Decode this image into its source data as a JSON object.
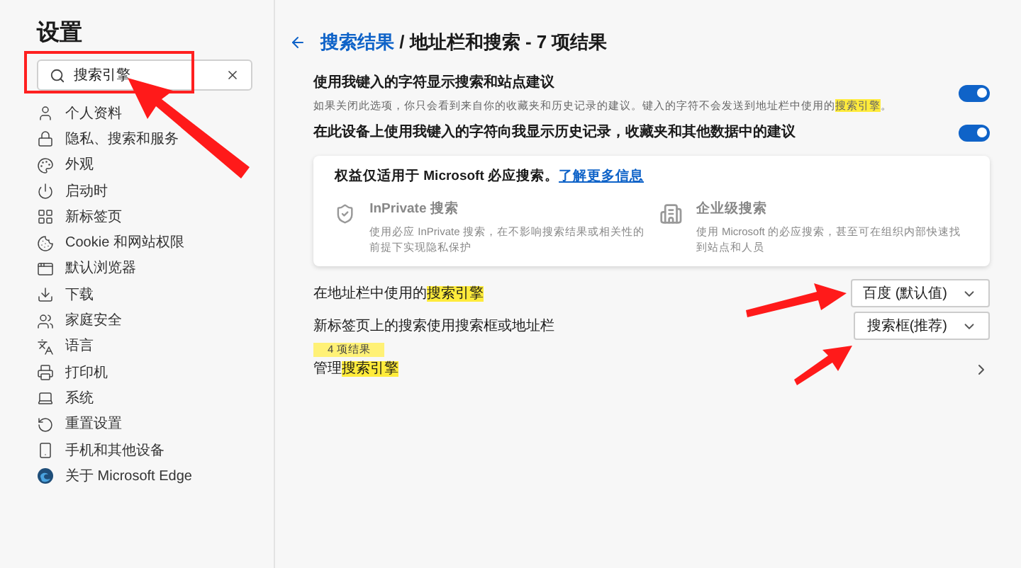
{
  "sidebar": {
    "title": "设置",
    "search": {
      "value": "搜索引擎"
    },
    "items": [
      {
        "kind": "profile",
        "label": "个人资料"
      },
      {
        "kind": "privacy",
        "label": "隐私、搜索和服务"
      },
      {
        "kind": "appearance",
        "label": "外观"
      },
      {
        "kind": "startup",
        "label": "启动时"
      },
      {
        "kind": "newtab",
        "label": "新标签页"
      },
      {
        "kind": "cookie",
        "label": "Cookie 和网站权限"
      },
      {
        "kind": "browser",
        "label": "默认浏览器"
      },
      {
        "kind": "download",
        "label": "下载"
      },
      {
        "kind": "family",
        "label": "家庭安全"
      },
      {
        "kind": "language",
        "label": "语言"
      },
      {
        "kind": "printer",
        "label": "打印机"
      },
      {
        "kind": "system",
        "label": "系统"
      },
      {
        "kind": "reset",
        "label": "重置设置"
      },
      {
        "kind": "phone",
        "label": "手机和其他设备"
      },
      {
        "kind": "edge",
        "label": "关于 Microsoft Edge"
      }
    ]
  },
  "header": {
    "link": "搜索结果",
    "rest": "/ 地址栏和搜索 - 7 项结果"
  },
  "toggles": [
    {
      "label": "使用我键入的字符显示搜索和站点建议",
      "desc": {
        "before": "如果关闭此选项，你只会看到来自你的收藏夹和历史记录的建议。键入的字符不会发送到地址栏中使用的",
        "highlight": "搜索引擎",
        "after": "。"
      },
      "on": true
    },
    {
      "label": "在此设备上使用我键入的字符向我显示历史记录，收藏夹和其他数据中的建议",
      "on": true
    }
  ],
  "card": {
    "text": "权益仅适用于 Microsoft 必应搜索。",
    "link": "了解更多信息",
    "features": [
      {
        "kind": "inprivate",
        "title": "InPrivate 搜索",
        "desc": "使用必应 InPrivate 搜索，在不影响搜索结果或相关性的前提下实现隐私保护"
      },
      {
        "kind": "enterprise",
        "title": "企业级搜索",
        "desc": "使用 Microsoft 的必应搜索，甚至可在组织内部快速找到站点和人员"
      }
    ]
  },
  "rows": [
    {
      "kind": "dropdown",
      "before": "在地址栏中使用的",
      "highlight": "搜索引擎",
      "value": "百度 (默认值)"
    },
    {
      "kind": "dropdown",
      "before": "新标签页上的搜索使用搜索框或地址栏",
      "value": "搜索框(推荐)"
    },
    {
      "kind": "link",
      "before": "管理",
      "highlight": "搜索引擎"
    }
  ],
  "tooltip": "4 项结果"
}
